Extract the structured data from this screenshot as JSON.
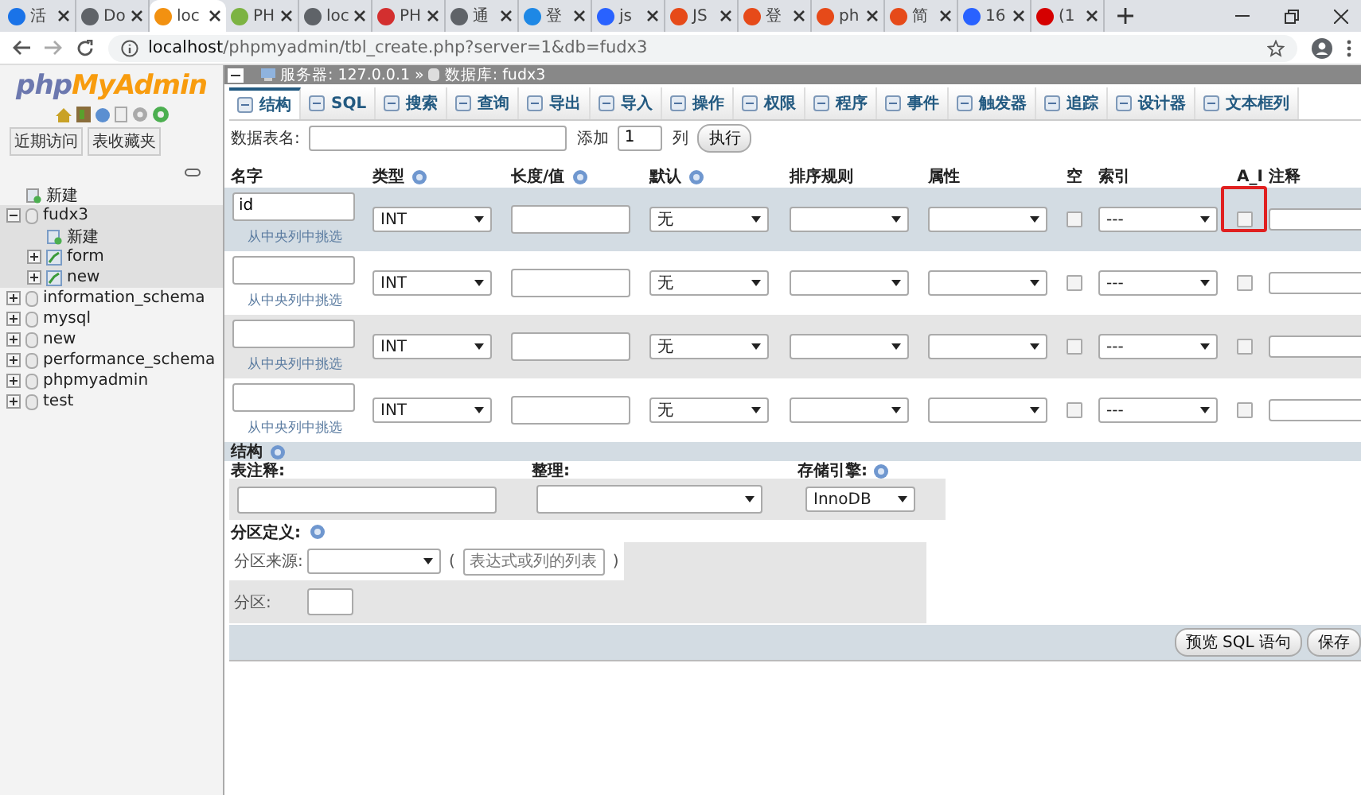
{
  "browser": {
    "tabs": [
      {
        "title": "活",
        "selected": false,
        "color": "#1a73e8"
      },
      {
        "title": "Do",
        "selected": false,
        "color": "#5f6368"
      },
      {
        "title": "loc",
        "selected": true,
        "color": "#f29111"
      },
      {
        "title": "PH",
        "selected": false,
        "color": "#7cb342"
      },
      {
        "title": "loc",
        "selected": false,
        "color": "#5f6368"
      },
      {
        "title": "PH",
        "selected": false,
        "color": "#d32f2f"
      },
      {
        "title": "通",
        "selected": false,
        "color": "#5f6368"
      },
      {
        "title": "登",
        "selected": false,
        "color": "#1e88e5"
      },
      {
        "title": "js",
        "selected": false,
        "color": "#2962ff"
      },
      {
        "title": "JS",
        "selected": false,
        "color": "#e64a19"
      },
      {
        "title": "登",
        "selected": false,
        "color": "#e64a19"
      },
      {
        "title": "ph",
        "selected": false,
        "color": "#e64a19"
      },
      {
        "title": "简",
        "selected": false,
        "color": "#e64a19"
      },
      {
        "title": "16",
        "selected": false,
        "color": "#2962ff"
      },
      {
        "title": "(1",
        "selected": false,
        "color": "#d50000"
      }
    ],
    "url": {
      "host": "localhost",
      "path": "/phpmyadmin/tbl_create.php?server=1&db=fudx3"
    }
  },
  "sidebar": {
    "logo": {
      "php": "php",
      "myadmin": "MyAdmin"
    },
    "buttons": [
      "近期访问",
      "表收藏夹"
    ],
    "tree": [
      {
        "label": "新建",
        "kind": "new",
        "selected": false
      },
      {
        "label": "fudx3",
        "kind": "db",
        "selected": true,
        "expanded": true,
        "children": [
          {
            "label": "新建",
            "kind": "new",
            "selected": false
          },
          {
            "label": "form",
            "kind": "table",
            "selected": false,
            "expanded": false
          },
          {
            "label": "new",
            "kind": "table",
            "selected": false,
            "expanded": false
          }
        ]
      },
      {
        "label": "information_schema",
        "kind": "db",
        "selected": false,
        "expanded": false
      },
      {
        "label": "mysql",
        "kind": "db",
        "selected": false,
        "expanded": false
      },
      {
        "label": "new",
        "kind": "db",
        "selected": false,
        "expanded": false
      },
      {
        "label": "performance_schema",
        "kind": "db",
        "selected": false,
        "expanded": false
      },
      {
        "label": "phpmyadmin",
        "kind": "db",
        "selected": false,
        "expanded": false
      },
      {
        "label": "test",
        "kind": "db",
        "selected": false,
        "expanded": false
      }
    ]
  },
  "breadcrumb": {
    "server_label": "服务器:",
    "server": "127.0.0.1",
    "sep": "»",
    "db_label": "数据库:",
    "db": "fudx3"
  },
  "menu": [
    {
      "label": "结构",
      "selected": true
    },
    {
      "label": "SQL",
      "selected": false
    },
    {
      "label": "搜索",
      "selected": false
    },
    {
      "label": "查询",
      "selected": false
    },
    {
      "label": "导出",
      "selected": false
    },
    {
      "label": "导入",
      "selected": false
    },
    {
      "label": "操作",
      "selected": false
    },
    {
      "label": "权限",
      "selected": false
    },
    {
      "label": "程序",
      "selected": false
    },
    {
      "label": "事件",
      "selected": false
    },
    {
      "label": "触发器",
      "selected": false
    },
    {
      "label": "追踪",
      "selected": false
    },
    {
      "label": "设计器",
      "selected": false
    },
    {
      "label": "文本框列",
      "selected": false
    }
  ],
  "table_form": {
    "name_label": "数据表名:",
    "add_label": "添加",
    "add_count": "1",
    "col_label": "列",
    "go": "执行"
  },
  "columns": [
    {
      "label": "名字"
    },
    {
      "label": "类型",
      "help": true
    },
    {
      "label": "长度/值",
      "help": true
    },
    {
      "label": "默认",
      "help": true
    },
    {
      "label": "排序规则"
    },
    {
      "label": "属性"
    },
    {
      "label": "空"
    },
    {
      "label": "索引"
    },
    {
      "label": "A_I"
    },
    {
      "label": "注释"
    }
  ],
  "rows": [
    {
      "name": "id",
      "pick": "从中央列中挑选",
      "type": "INT",
      "default": "无",
      "null": false,
      "index": "---",
      "ai": false,
      "highlight": true
    },
    {
      "pick": "从中央列中挑选",
      "type": "INT",
      "default": "无",
      "null": false,
      "index": "---",
      "ai": false
    },
    {
      "pick": "从中央列中挑选",
      "type": "INT",
      "default": "无",
      "null": false,
      "index": "---",
      "ai": false
    },
    {
      "pick": "从中央列中挑选",
      "type": "INT",
      "default": "无",
      "null": false,
      "index": "---",
      "ai": false
    }
  ],
  "structure": {
    "title": "结构",
    "comment_label": "表注释:",
    "collation_label": "整理:",
    "engine_label": "存储引擎:",
    "engine": "InnoDB"
  },
  "partition": {
    "title": "分区定义:",
    "source_label": "分区来源:",
    "open": "(",
    "expr_placeholder": "表达式或列的列表",
    "close": ")",
    "count_label": "分区:"
  },
  "actions": [
    "预览 SQL 语句",
    "保存"
  ]
}
